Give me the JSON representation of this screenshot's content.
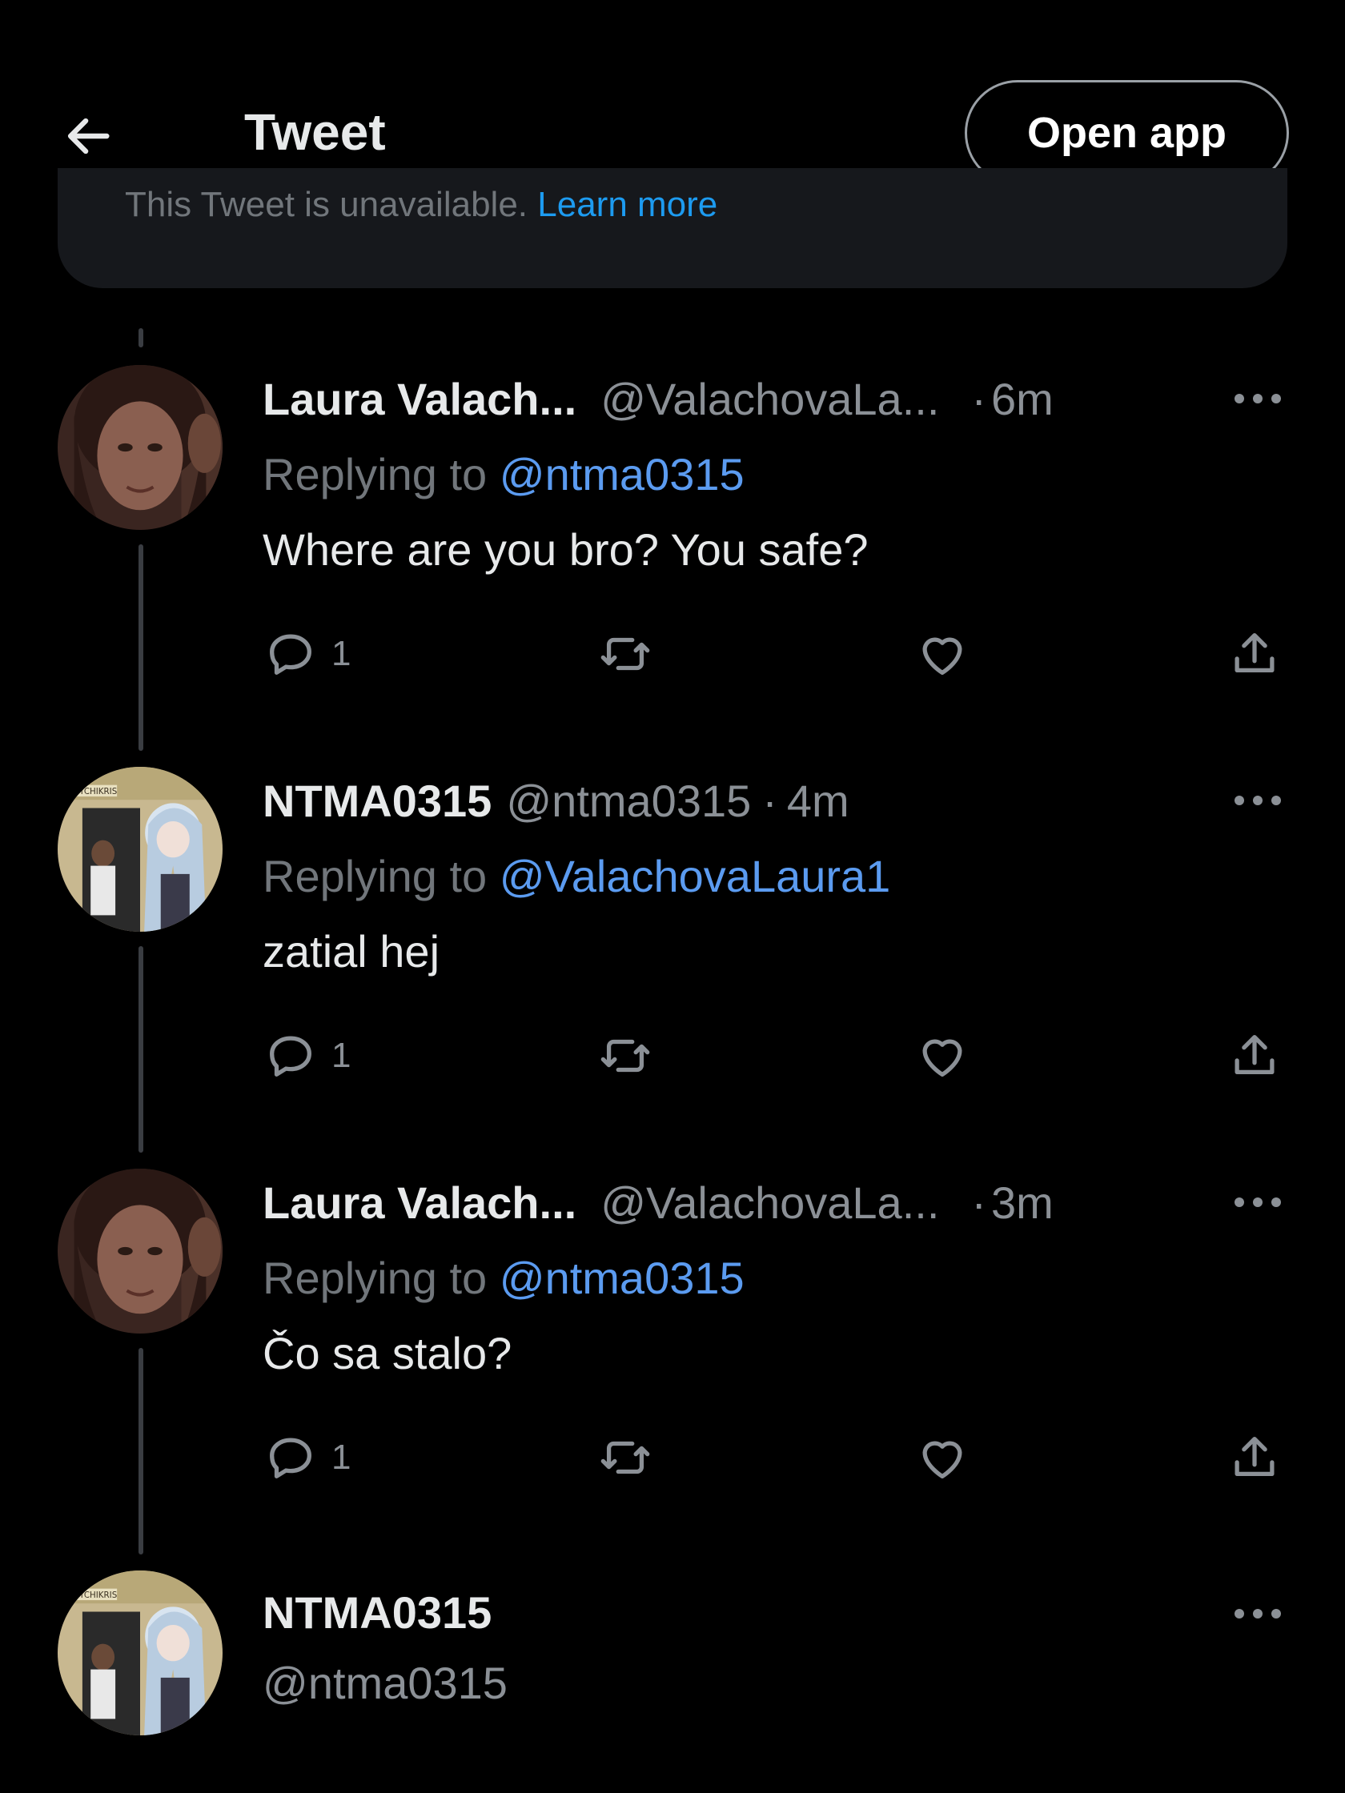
{
  "header": {
    "title": "Tweet",
    "open_app_label": "Open app"
  },
  "unavailable_notice": {
    "text": "This Tweet is unavailable.",
    "link": "Learn more"
  },
  "tweets": [
    {
      "display_name": "Laura Valach...",
      "handle": "@ValachovaLa...",
      "separator": "·",
      "time": "6m",
      "replying_prefix": "Replying to",
      "replying_to": "@ntma0315",
      "text": "Where are you bro? You safe?",
      "reply_count": "1"
    },
    {
      "display_name": "NTMA0315",
      "handle": "@ntma0315",
      "separator": "·",
      "time": "4m",
      "replying_prefix": "Replying to",
      "replying_to": "@ValachovaLaura1",
      "text": "zatial hej",
      "reply_count": "1"
    },
    {
      "display_name": "Laura Valach...",
      "handle": "@ValachovaLa...",
      "separator": "·",
      "time": "3m",
      "replying_prefix": "Replying to",
      "replying_to": "@ntma0315",
      "text": "Čo sa stalo?",
      "reply_count": "1"
    },
    {
      "display_name": "NTMA0315",
      "handle": "@ntma0315"
    }
  ],
  "avatar_sign_text": "PSYCHIKRIS",
  "icons": {
    "back": "arrow-left-icon",
    "more": "more-horizontal-icon",
    "reply": "chat-bubble-icon",
    "retweet": "retweet-icon",
    "like": "heart-icon",
    "share": "share-icon"
  },
  "colors": {
    "background": "#000000",
    "text_primary": "#e7e9ea",
    "text_secondary": "#8b9096",
    "link": "#5b9bf0",
    "card": "#16181c",
    "thread_line": "#3a3d42"
  }
}
